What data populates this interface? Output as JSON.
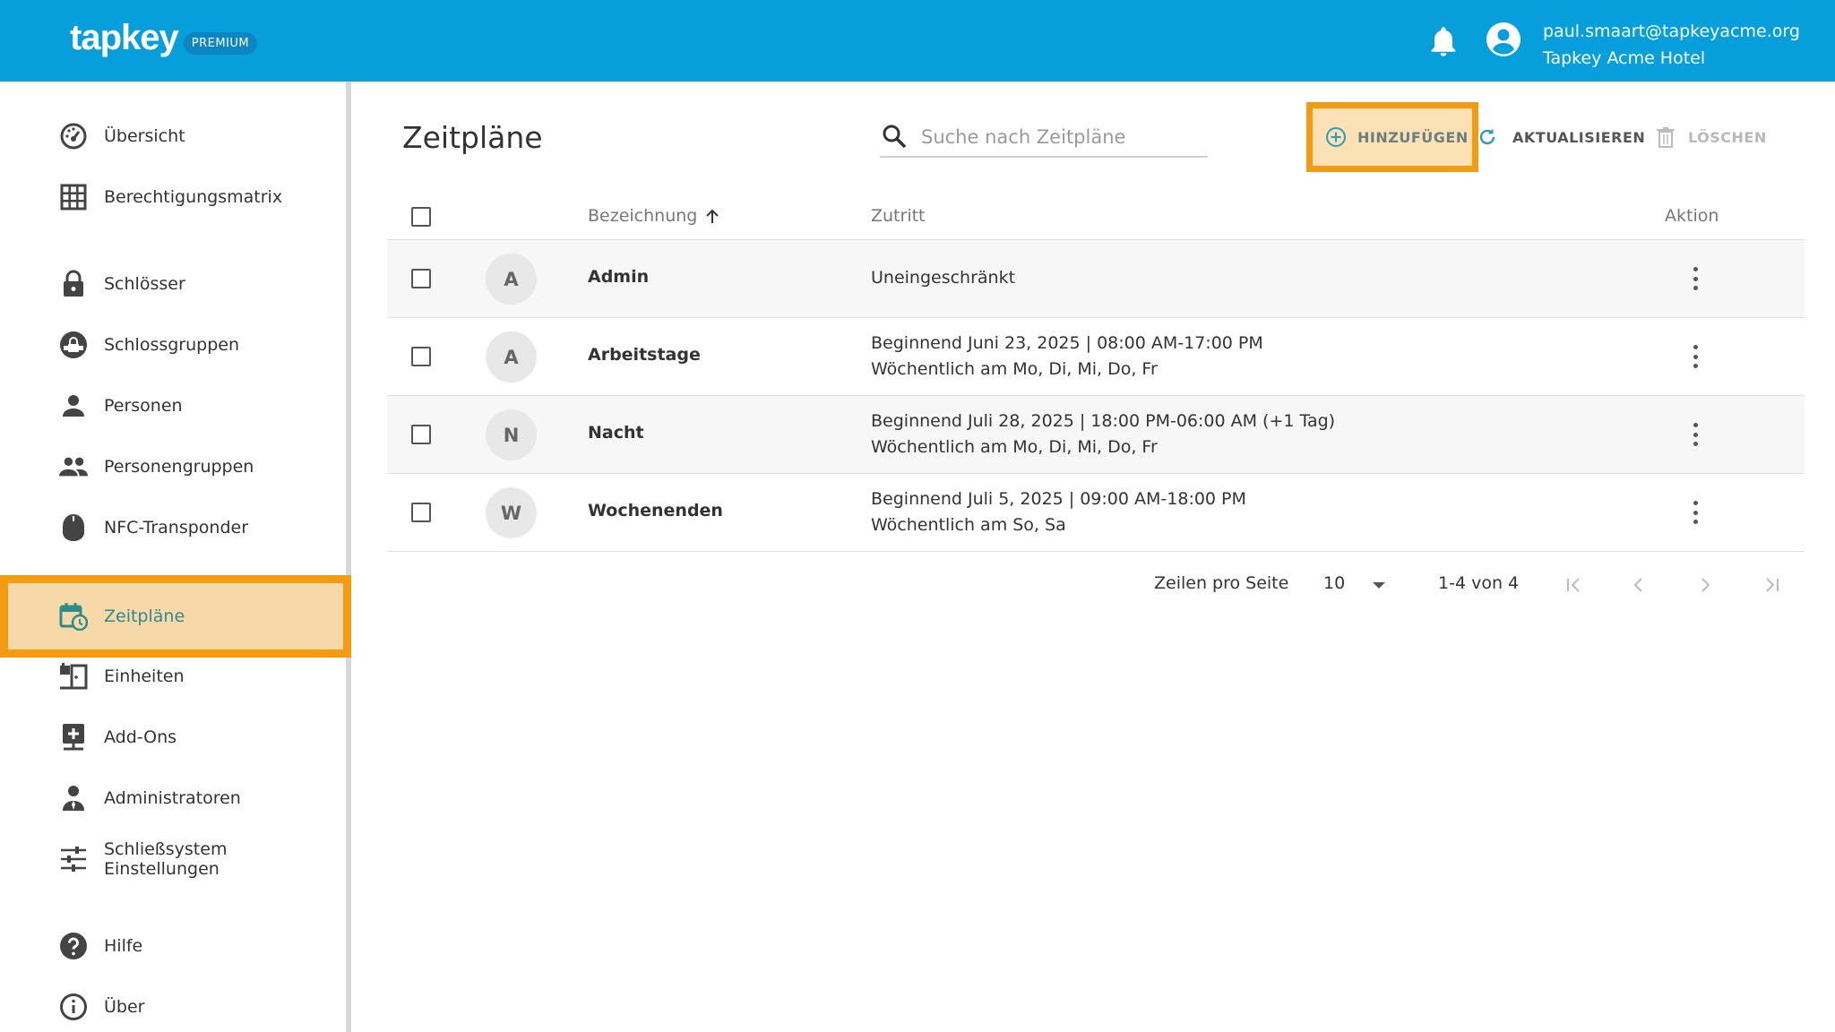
{
  "header": {
    "logo_text": "tapkey",
    "badge": "PREMIUM",
    "user_email": "paul.smaart@tapkeyacme.org",
    "user_org": "Tapkey Acme Hotel"
  },
  "sidebar": {
    "items": [
      {
        "label": "Übersicht",
        "icon": "dashboard-icon"
      },
      {
        "label": "Berechtigungsmatrix",
        "icon": "grid-icon"
      },
      {
        "label": "Schlösser",
        "icon": "lock-icon"
      },
      {
        "label": "Schlossgruppen",
        "icon": "lock-group-icon"
      },
      {
        "label": "Personen",
        "icon": "person-icon"
      },
      {
        "label": "Personengruppen",
        "icon": "people-icon"
      },
      {
        "label": "NFC-Transponder",
        "icon": "nfc-tag-icon"
      },
      {
        "label": "Zeitpläne",
        "icon": "calendar-clock-icon",
        "active": true
      },
      {
        "label": "Einheiten",
        "icon": "units-icon"
      },
      {
        "label": "Add-Ons",
        "icon": "addon-icon"
      },
      {
        "label": "Administratoren",
        "icon": "admin-icon"
      },
      {
        "label": "Schließsystem Einstellungen",
        "icon": "sliders-icon"
      },
      {
        "label": "Hilfe",
        "icon": "help-icon"
      },
      {
        "label": "Über",
        "icon": "info-icon"
      }
    ]
  },
  "main": {
    "title": "Zeitpläne",
    "search_placeholder": "Suche nach Zeitpläne",
    "toolbar": {
      "add_label": "HINZUFÜGEN",
      "refresh_label": "AKTUALISIEREN",
      "delete_label": "LÖSCHEN"
    },
    "table": {
      "columns": [
        "Bezeichnung",
        "Zutritt",
        "Aktion"
      ],
      "rows": [
        {
          "initial": "A",
          "name": "Admin",
          "access_line1": "Uneingeschränkt",
          "access_line2": ""
        },
        {
          "initial": "A",
          "name": "Arbeitstage",
          "access_line1": "Beginnend Juni 23, 2025 | 08:00 AM-17:00 PM",
          "access_line2": "Wöchentlich am Mo, Di, Mi, Do, Fr"
        },
        {
          "initial": "N",
          "name": "Nacht",
          "access_line1": "Beginnend Juli 28, 2025 | 18:00 PM-06:00 AM (+1 Tag)",
          "access_line2": "Wöchentlich am Mo, Di, Mi, Do, Fr"
        },
        {
          "initial": "W",
          "name": "Wochenenden",
          "access_line1": "Beginnend Juli 5, 2025 | 09:00 AM-18:00 PM",
          "access_line2": "Wöchentlich am So, Sa"
        }
      ]
    },
    "pagination": {
      "rows_per_page_label": "Zeilen pro Seite",
      "rows_per_page_value": "10",
      "range_text": "1-4 von 4"
    }
  },
  "colors": {
    "header_bg": "#069fdc",
    "highlight_border": "#f39c12",
    "highlight_fill": "#f7d9a9",
    "accent_teal": "#2e8b8b"
  }
}
